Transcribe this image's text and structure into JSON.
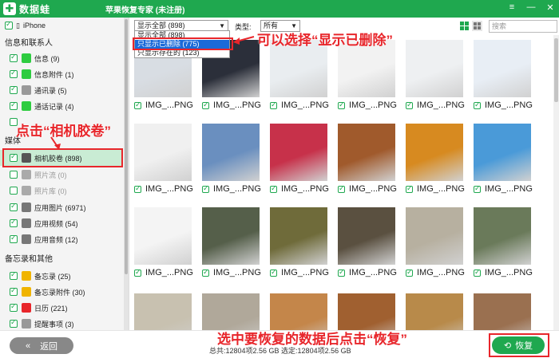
{
  "window": {
    "app_name": "数据蛙",
    "title": "苹果恢复专家 (未注册)",
    "controls": [
      "≡",
      "—",
      "✕"
    ]
  },
  "sidebar": {
    "device": "iPhone",
    "sections": [
      {
        "heading": "信息和联系人",
        "items": [
          {
            "label": "信息 (9)",
            "icon_color": "#2ecc40",
            "checked": true
          },
          {
            "label": "信息附件 (1)",
            "icon_color": "#2ecc40",
            "checked": true
          },
          {
            "label": "通讯录 (5)",
            "icon_color": "#999999",
            "checked": true
          },
          {
            "label": "通话记录 (4)",
            "icon_color": "#2ecc40",
            "checked": true
          },
          {
            "label": "",
            "icon_color": "#cccccc",
            "checked": false
          }
        ]
      },
      {
        "heading": "媒体",
        "items": [
          {
            "label": "相机胶卷 (898)",
            "icon_color": "#555555",
            "checked": true,
            "selected": true
          },
          {
            "label": "照片流 (0)",
            "icon_color": "#aaaaaa",
            "checked": false
          },
          {
            "label": "照片库 (0)",
            "icon_color": "#aaaaaa",
            "checked": false
          },
          {
            "label": "应用图片 (6971)",
            "icon_color": "#777777",
            "checked": true
          },
          {
            "label": "应用视频 (54)",
            "icon_color": "#777777",
            "checked": true
          },
          {
            "label": "应用音频 (12)",
            "icon_color": "#777777",
            "checked": true
          }
        ]
      },
      {
        "heading": "备忘录和其他",
        "items": [
          {
            "label": "备忘录 (25)",
            "icon_color": "#f0b400",
            "checked": true
          },
          {
            "label": "备忘录附件 (30)",
            "icon_color": "#f0b400",
            "checked": true
          },
          {
            "label": "日历 (221)",
            "icon_color": "#e8262b",
            "checked": true
          },
          {
            "label": "提醒事项 (3)",
            "icon_color": "#999999",
            "checked": true
          }
        ]
      }
    ]
  },
  "toolbar": {
    "filter_value": "显示全部 (898)",
    "type_label": "类型:",
    "type_value": "所有",
    "search_placeholder": "搜索"
  },
  "dropdown": {
    "options": [
      "显示全部 (898)",
      "只显示已删除 (775)",
      "只显示存在的 (123)"
    ],
    "highlighted": 1
  },
  "grid": {
    "file_name": "IMG_...PNG",
    "rows": [
      [
        "#d8dde3",
        "#2b2f3a",
        "#e9edf0",
        "#f2f2f2",
        "#eef0f2",
        "#e8eef5"
      ],
      [
        "#f0f0f0",
        "#6a8fbf",
        "#c7314a",
        "#a05a2c",
        "#d78a20",
        "#4a9ad8"
      ],
      [
        "#f4f4f4",
        "#555f4a",
        "#6f6b3a",
        "#5a5040",
        "#b7b0a0",
        "#6a7a5a"
      ],
      [
        "#c8c1b0",
        "#b0a89a",
        "#c4864a",
        "#a06030",
        "#b88a4a",
        "#9a7050"
      ]
    ]
  },
  "bottombar": {
    "back_label": "返回",
    "status": "总共:12804项2.56 GB 选定:12804项2.56 GB",
    "recover_label": "恢复"
  },
  "annotations": {
    "dropdown_tip": "可以选择“显示已删除”",
    "sidebar_tip": "点击“相机胶卷”",
    "bottom_tip": "选中要恢复的数据后点击“恢复”"
  }
}
